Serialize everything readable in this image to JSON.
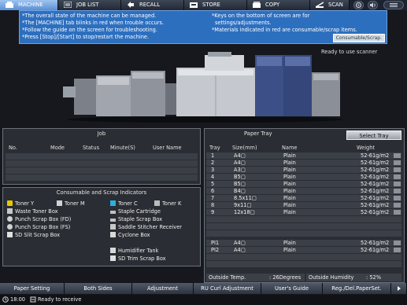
{
  "tabs": [
    {
      "label": "MACHINE",
      "icon": "machine-icon",
      "active": true
    },
    {
      "label": "JOB LIST",
      "icon": "job-list-icon"
    },
    {
      "label": "RECALL",
      "icon": "recall-icon"
    },
    {
      "label": "STORE",
      "icon": "store-icon"
    },
    {
      "label": "COPY",
      "icon": "copy-icon"
    },
    {
      "label": "SCAN",
      "icon": "scan-icon"
    }
  ],
  "info": {
    "lines_left": [
      "*The overall state of the machine can be managed.",
      "*The [MACHINE] tab blinks in red when trouble occurs.",
      "*Follow the guide on the screen for troubleshooting.",
      "*Press [Stop]/[Start] to stop/restart the machine."
    ],
    "lines_right": [
      "*Keys on the bottom of screen are for",
      "settings/adjustments.",
      "*Materials indicated in red are consumable/scrap items."
    ],
    "button": "Consumable/Scrap."
  },
  "status_top": "Ready to use scanner",
  "job": {
    "title": "Job",
    "columns": [
      "No.",
      "Mode",
      "Status",
      "Minute(S)",
      "User Name"
    ]
  },
  "consumables": {
    "title": "Consumable and Scrap Indicators",
    "left": [
      "Toner Y",
      "Toner M",
      "Waste Toner Box",
      "Punch Scrap Box (FD)",
      "Punch Scrap Box (FS)",
      "SD Slit Scrap Box"
    ],
    "right": [
      "Toner C",
      "Toner K",
      "Staple Cartridge",
      "Staple Scrap Box",
      "Saddle Stitcher Receiver",
      "Cyclone Box",
      "Humidifier Tank",
      "SD Trim Scrap Box"
    ]
  },
  "paper_tray": {
    "title": "Paper Tray",
    "select_button": "Select Tray",
    "columns": [
      "Tray",
      "Size(mm)",
      "Name",
      "Weight"
    ],
    "rows": [
      {
        "tray": "1",
        "size": "A4▢",
        "name": "Plain",
        "weight": "52-61g/m2"
      },
      {
        "tray": "2",
        "size": "A4▢",
        "name": "Plain",
        "weight": "52-61g/m2"
      },
      {
        "tray": "3",
        "size": "A3▢",
        "name": "Plain",
        "weight": "52-61g/m2"
      },
      {
        "tray": "4",
        "size": "B5▢",
        "name": "Plain",
        "weight": "52-61g/m2"
      },
      {
        "tray": "5",
        "size": "B5▢",
        "name": "Plain",
        "weight": "52-61g/m2"
      },
      {
        "tray": "6",
        "size": "B4▢",
        "name": "Plain",
        "weight": "52-61g/m2"
      },
      {
        "tray": "7",
        "size": "8.5x11▢",
        "name": "Plain",
        "weight": "52-61g/m2"
      },
      {
        "tray": "8",
        "size": "9x11▢",
        "name": "Plain",
        "weight": "52-61g/m2"
      },
      {
        "tray": "9",
        "size": "12x18▢",
        "name": "Plain",
        "weight": "52-61g/m2"
      },
      {
        "tray": "PI1",
        "size": "A4▢",
        "name": "Plain",
        "weight": "52-61g/m2"
      },
      {
        "tray": "PI2",
        "size": "A4▢",
        "name": "Plain",
        "weight": "52-61g/m2"
      }
    ],
    "outside_temp_label": "Outside Temp.",
    "outside_temp_value": ": 26Degrees",
    "outside_humidity_label": "Outside Humidity",
    "outside_humidity_value": ": 52%"
  },
  "bottom_buttons": [
    "Paper Setting",
    "Both Sides",
    "Adjustment",
    "RU Curl Adjustment",
    "User's Guide",
    "Reg./Del.PaperSet."
  ],
  "statusbar": {
    "time": "18:00",
    "message": "Ready to receive"
  },
  "colors": {
    "info_bg": "#2d6fbf",
    "active_tab": "#7aa8e6",
    "panel_bg": "#2a2d33"
  }
}
